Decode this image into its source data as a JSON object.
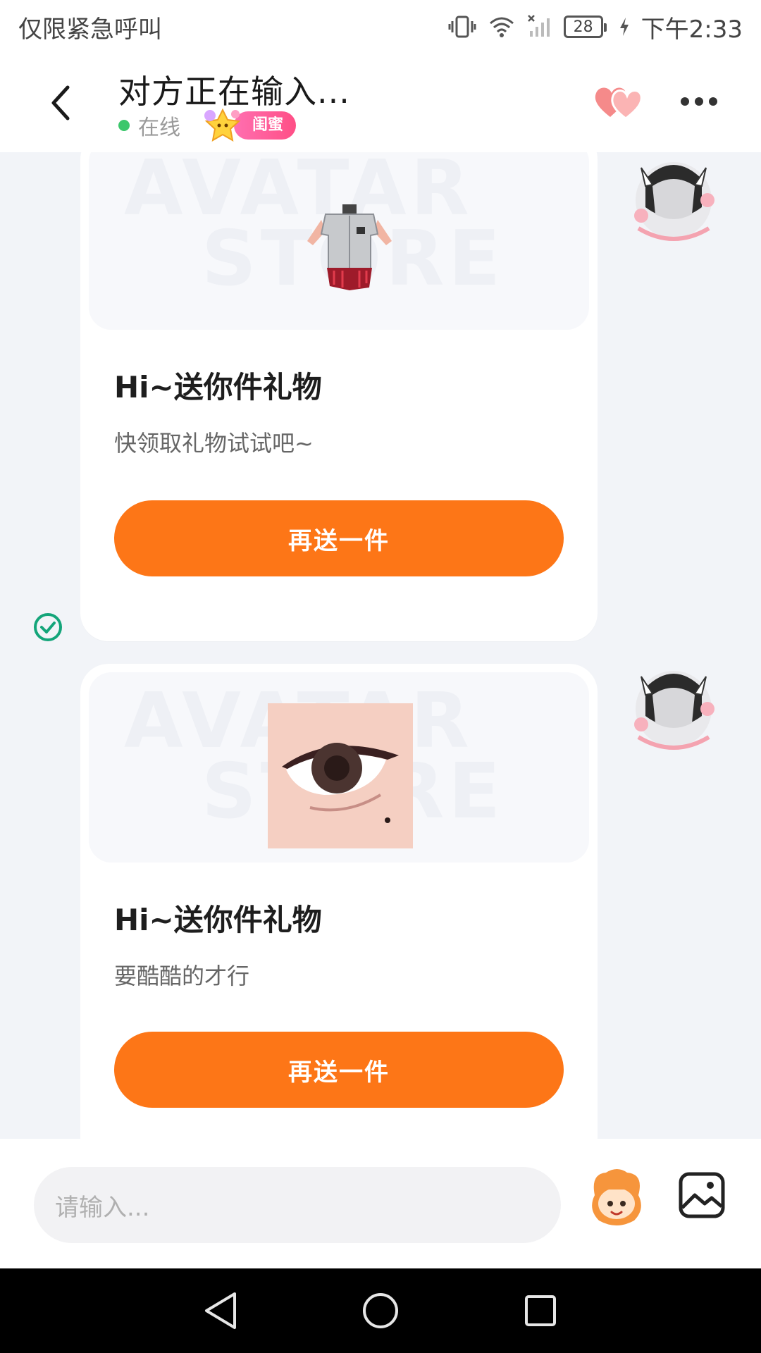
{
  "statusbar": {
    "left_text": "仅限紧急呼叫",
    "battery": "28",
    "time": "下午2:33",
    "icons": [
      "vibrate-icon",
      "wifi-icon",
      "no-signal-icon",
      "battery-icon",
      "charging-icon"
    ]
  },
  "header": {
    "title": "对方正在输入...",
    "online_text": "在线",
    "relation_badge": "闺蜜",
    "icons": [
      "back-icon",
      "hearts-icon",
      "more-icon"
    ]
  },
  "chat": {
    "watermark_line1": "AVATAR",
    "watermark_line2": "STORE",
    "messages": [
      {
        "title": "Hi~送你件礼物",
        "subtitle": "快领取礼物试试吧~",
        "button": "再送一件",
        "item": "shirt-clothing",
        "status": "sent-check-icon"
      },
      {
        "title": "Hi~送你件礼物",
        "subtitle": "要酷酷的才行",
        "button": "再送一件",
        "item": "eye-makeup"
      }
    ]
  },
  "inputbar": {
    "placeholder": "请输入...",
    "icons": [
      "emoji-avatar-icon",
      "image-icon"
    ]
  },
  "navbar": {
    "icons": [
      "back-triangle-icon",
      "home-circle-icon",
      "recents-square-icon"
    ]
  },
  "colors": {
    "accent": "#fd7617",
    "online": "#3cc76c",
    "badge": "#ff5a8f",
    "check": "#14a57a"
  }
}
